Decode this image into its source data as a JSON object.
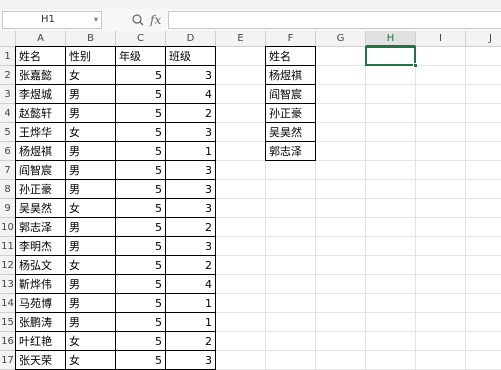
{
  "name_box": {
    "value": "H1"
  },
  "formula_bar": {
    "fx_label": "fx",
    "value": ""
  },
  "columns": [
    "A",
    "B",
    "C",
    "D",
    "E",
    "F",
    "G",
    "H",
    "I",
    "J"
  ],
  "selected_column": "H",
  "rows": [
    "1",
    "2",
    "3",
    "4",
    "5",
    "6",
    "7",
    "8",
    "9",
    "10",
    "11",
    "12",
    "13",
    "14",
    "15",
    "16",
    "17"
  ],
  "table1": {
    "headers": [
      "姓名",
      "性别",
      "年级",
      "班级"
    ],
    "records": [
      [
        "张嘉懿",
        "女",
        "5",
        "3"
      ],
      [
        "李煜城",
        "男",
        "5",
        "4"
      ],
      [
        "赵懿轩",
        "男",
        "5",
        "2"
      ],
      [
        "王烨华",
        "女",
        "5",
        "3"
      ],
      [
        "杨煜祺",
        "男",
        "5",
        "1"
      ],
      [
        "阎智宸",
        "男",
        "5",
        "3"
      ],
      [
        "孙正豪",
        "男",
        "5",
        "3"
      ],
      [
        "吴昊然",
        "女",
        "5",
        "3"
      ],
      [
        "郭志泽",
        "男",
        "5",
        "2"
      ],
      [
        "李明杰",
        "男",
        "5",
        "3"
      ],
      [
        "杨弘文",
        "女",
        "5",
        "2"
      ],
      [
        "靳烨伟",
        "男",
        "5",
        "4"
      ],
      [
        "马苑博",
        "男",
        "5",
        "1"
      ],
      [
        "张鹏涛",
        "男",
        "5",
        "1"
      ],
      [
        "叶红艳",
        "女",
        "5",
        "2"
      ],
      [
        "张天荣",
        "女",
        "5",
        "3"
      ]
    ]
  },
  "table2": {
    "header": "姓名",
    "values": [
      "杨煜祺",
      "阎智宸",
      "孙正豪",
      "吴昊然",
      "郭志泽"
    ]
  },
  "colors": {
    "accent": "#217346"
  }
}
